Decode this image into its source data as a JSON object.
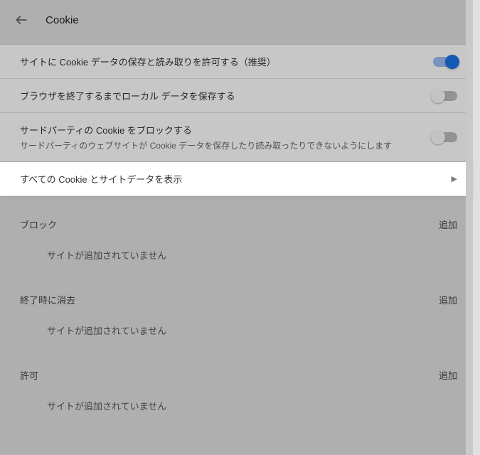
{
  "header": {
    "title": "Cookie"
  },
  "settings": {
    "allow_save": {
      "label": "サイトに Cookie データの保存と読み取りを許可する（推奨）",
      "on": true
    },
    "keep_until_quit": {
      "label": "ブラウザを終了するまでローカル データを保存する",
      "on": false
    },
    "block_third_party": {
      "label": "サードパーティの Cookie をブロックする",
      "sublabel": "サードパーティのウェブサイトが Cookie データを保存したり読み取ったりできないようにします",
      "on": false
    },
    "see_all": {
      "label": "すべての Cookie とサイトデータを表示"
    }
  },
  "sections": {
    "block": {
      "title": "ブロック",
      "add": "追加",
      "empty": "サイトが追加されていません"
    },
    "clear_on_exit": {
      "title": "終了時に消去",
      "add": "追加",
      "empty": "サイトが追加されていません"
    },
    "allow": {
      "title": "許可",
      "add": "追加",
      "empty": "サイトが追加されていません"
    }
  }
}
